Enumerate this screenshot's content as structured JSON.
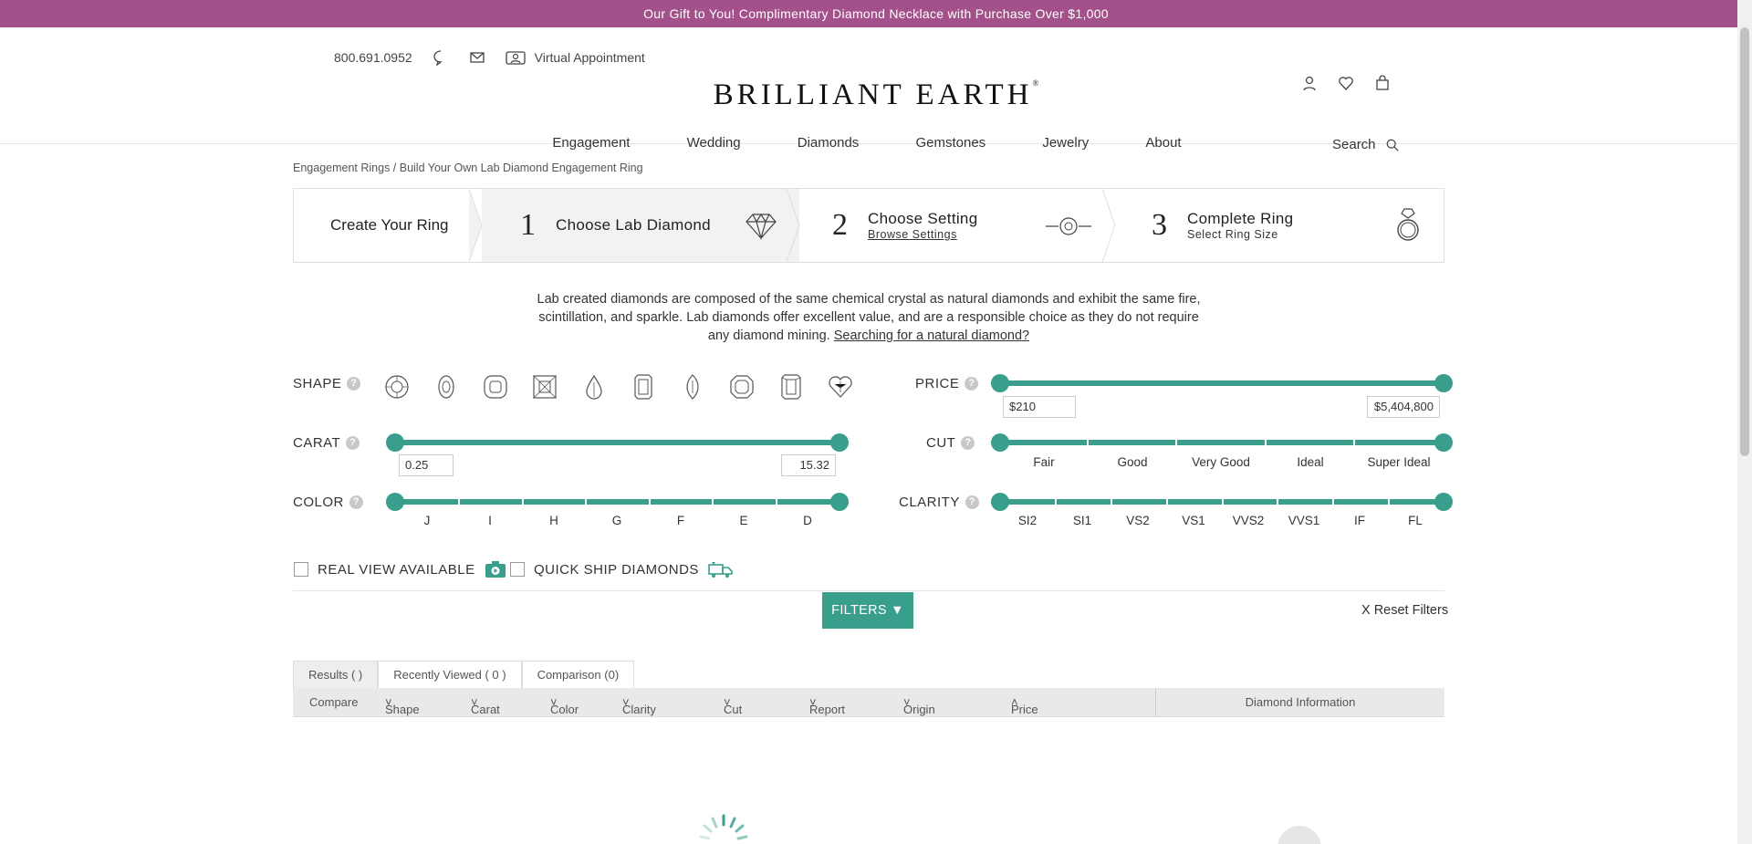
{
  "promo": "Our Gift to You! Complimentary Diamond Necklace with Purchase Over $1,000",
  "header": {
    "phone": "800.691.0952",
    "virtual_appt": "Virtual Appointment",
    "logo": "BRILLIANT EARTH",
    "logo_mark": "®",
    "nav": [
      "Engagement",
      "Wedding",
      "Diamonds",
      "Gemstones",
      "Jewelry",
      "About"
    ],
    "search": "Search"
  },
  "breadcrumb": "Engagement Rings / Build Your Own Lab Diamond Engagement Ring",
  "steps": {
    "create": "Create Your Ring",
    "s1": {
      "num": "1",
      "title": "Choose Lab Diamond"
    },
    "s2": {
      "num": "2",
      "title": "Choose Setting",
      "sub": "Browse Settings"
    },
    "s3": {
      "num": "3",
      "title": "Complete Ring",
      "sub": "Select Ring Size"
    }
  },
  "intro": {
    "text": "Lab created diamonds are composed of the same chemical crystal as natural diamonds and exhibit the same fire, scintillation, and sparkle. Lab diamonds offer excellent value, and are a responsible choice as they do not require any diamond mining. ",
    "link": "Searching for a natural diamond?"
  },
  "filters": {
    "shape": {
      "label": "SHAPE",
      "shapes": [
        "round-icon",
        "oval-icon",
        "cushion-icon",
        "princess-icon",
        "pear-icon",
        "emerald-icon",
        "marquise-icon",
        "asscher-icon",
        "radiant-icon",
        "heart-icon"
      ]
    },
    "price": {
      "label": "PRICE",
      "min": "$210",
      "max": "$5,404,800"
    },
    "carat": {
      "label": "CARAT",
      "min": "0.25",
      "max": "15.32"
    },
    "cut": {
      "label": "CUT",
      "ticks": [
        "Fair",
        "Good",
        "Very Good",
        "Ideal",
        "Super Ideal"
      ]
    },
    "color": {
      "label": "COLOR",
      "ticks": [
        "J",
        "I",
        "H",
        "G",
        "F",
        "E",
        "D"
      ]
    },
    "clarity": {
      "label": "CLARITY",
      "ticks": [
        "SI2",
        "SI1",
        "VS2",
        "VS1",
        "VVS2",
        "VVS1",
        "IF",
        "FL"
      ]
    },
    "help": "?",
    "real_view": "REAL VIEW AVAILABLE",
    "quick_ship": "QUICK SHIP DIAMONDS",
    "filters_btn": "FILTERS",
    "reset": "X Reset Filters"
  },
  "tabs": [
    "Results (   )",
    "Recently Viewed ( 0 )",
    "Comparison (0)"
  ],
  "columns": [
    "Compare",
    "Shape",
    "Carat",
    "Color",
    "Clarity",
    "Cut",
    "Report",
    "Origin",
    "Price"
  ],
  "diamond_info": "Diamond Information",
  "colors": {
    "accent": "#3a9e8d",
    "promo": "#a4508b"
  }
}
